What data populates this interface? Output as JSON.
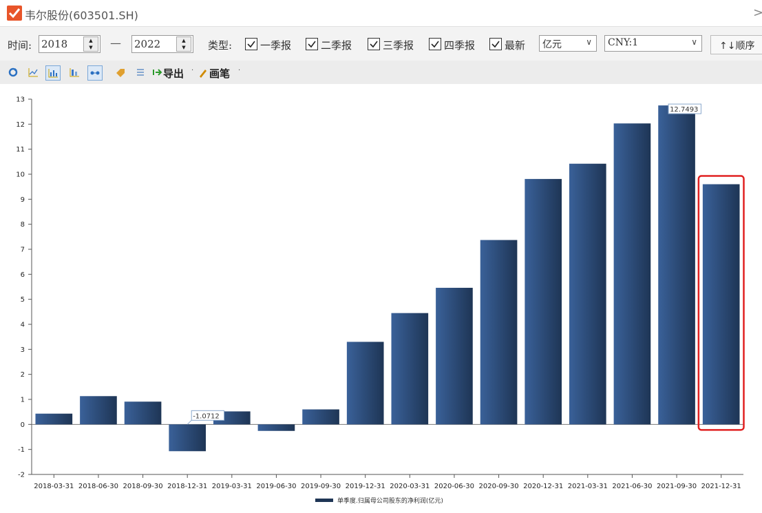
{
  "window": {
    "title": "韦尔股份(603501.SH)"
  },
  "filters": {
    "time_label": "时间:",
    "start_year": "2018",
    "separator": "—",
    "end_year": "2022",
    "type_label": "类型:",
    "checkboxes": [
      {
        "label": "一季报",
        "checked": true
      },
      {
        "label": "二季报",
        "checked": true
      },
      {
        "label": "三季报",
        "checked": true
      },
      {
        "label": "四季报",
        "checked": true
      },
      {
        "label": "最新",
        "checked": true
      }
    ],
    "unit_select": "亿元",
    "currency_select": "CNY:1",
    "sort_button": "↑↓顺序"
  },
  "toolbar": {
    "export_label": "导出",
    "pen_label": "画笔",
    "icons": [
      "refresh-icon",
      "line-chart-icon",
      "bar-chart-icon",
      "stacked-bar-icon",
      "range-icon",
      "tag-icon",
      "list-icon",
      "export-icon",
      "pen-icon"
    ]
  },
  "chart_data": {
    "type": "bar",
    "categories": [
      "2018-03-31",
      "2018-06-30",
      "2018-09-30",
      "2018-12-31",
      "2019-03-31",
      "2019-06-30",
      "2019-09-30",
      "2019-12-31",
      "2020-03-31",
      "2020-06-30",
      "2020-09-30",
      "2020-12-31",
      "2021-03-31",
      "2021-06-30",
      "2021-09-30",
      "2021-12-31"
    ],
    "series": [
      {
        "name": "单季度.归属母公司股东的净利润(亿元)",
        "values": [
          0.43,
          1.13,
          0.91,
          -1.0712,
          0.52,
          -0.26,
          0.6,
          3.3,
          4.45,
          5.46,
          7.37,
          9.81,
          10.42,
          12.03,
          12.7493,
          9.6
        ]
      }
    ],
    "ylim": [
      -2,
      13
    ],
    "yticks": [
      "-2",
      "-1",
      "0",
      "1",
      "2",
      "3",
      "4",
      "5",
      "6",
      "7",
      "8",
      "9",
      "10",
      "11",
      "12",
      "13"
    ],
    "data_labels": [
      {
        "index": 3,
        "text": "-1.0712"
      },
      {
        "index": 14,
        "text": "12.7493"
      }
    ],
    "highlight_index": 15,
    "highlight_color": "#e02020",
    "bar_color_dark": "#1e3555",
    "bar_color_light": "#3a6199"
  }
}
